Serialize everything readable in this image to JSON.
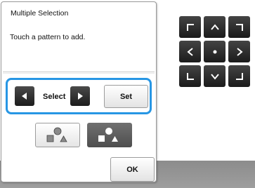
{
  "dialog": {
    "title": "Multiple Selection",
    "message": "Touch a pattern to add.",
    "select_label": "Select",
    "set_label": "Set",
    "ok_label": "OK"
  },
  "icons": {
    "select_prev": "triangle-left-icon",
    "select_next": "triangle-right-icon",
    "pattern_mode_light": "shapes-icon",
    "pattern_mode_dark": "shapes-icon",
    "pad_up_left": "corner-up-left-icon",
    "pad_up": "chevron-up-icon",
    "pad_up_right": "corner-up-right-icon",
    "pad_left": "chevron-left-icon",
    "pad_center": "center-dot-icon",
    "pad_right": "chevron-right-icon",
    "pad_down_left": "corner-down-left-icon",
    "pad_down": "chevron-down-icon",
    "pad_down_right": "corner-down-right-icon"
  },
  "colors": {
    "highlight": "#2796e4",
    "dark_button": "#2a2a2a",
    "bottom_strip": "#959595"
  }
}
